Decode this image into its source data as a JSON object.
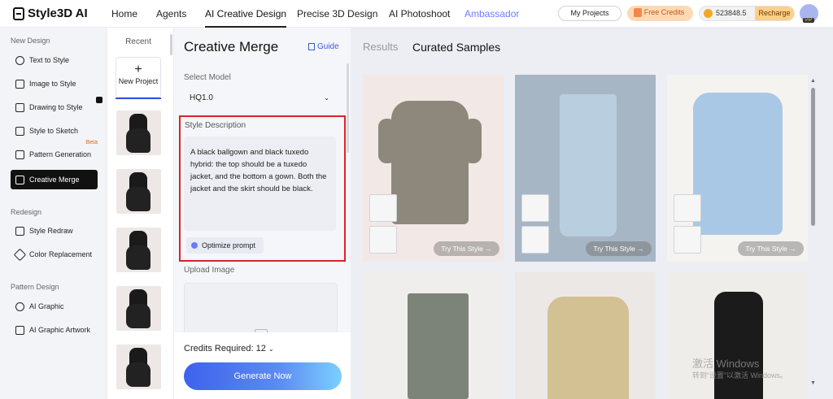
{
  "app": {
    "logo_text": "Style3D AI"
  },
  "topnav": {
    "items": [
      {
        "label": "Home"
      },
      {
        "label": "Agents"
      },
      {
        "label": "AI Creative Design"
      },
      {
        "label": "Precise 3D Design"
      },
      {
        "label": "AI Photoshoot"
      },
      {
        "label": "Ambassador"
      }
    ],
    "active": "AI Creative Design",
    "my_projects": "My Projects",
    "free_credits": "Free Credits",
    "credits_value": "523848.5",
    "recharge": "Recharge",
    "avatar_badge": "VIP"
  },
  "sidebar": {
    "sections": [
      {
        "title": "New Design",
        "items": [
          "Text to Style",
          "Image to Style",
          "Drawing to Style",
          "Style to Sketch",
          "Pattern Generation",
          "Creative Merge"
        ]
      },
      {
        "title": "Redesign",
        "items": [
          "Style Redraw",
          "Color Replacement"
        ]
      },
      {
        "title": "Pattern Design",
        "items": [
          "AI Graphic",
          "AI Graphic Artwork"
        ]
      }
    ],
    "beta_label": "Beta",
    "active": "Creative Merge"
  },
  "recent": {
    "title": "Recent",
    "new_project": "New Project"
  },
  "form": {
    "title": "Creative Merge",
    "guide": "Guide",
    "select_model_label": "Select Model",
    "model_value": "HQ1.0",
    "style_description_label": "Style Description",
    "style_description_text": "A black ballgown and black tuxedo hybrid: the top should be a tuxedo jacket, and the bottom a gown. Both the jacket and the skirt should be black.",
    "optimize_prompt": "Optimize prompt",
    "upload_image_label": "Upload Image",
    "credits_required": "Credits Required: 12",
    "generate_button": "Generate Now"
  },
  "results": {
    "tabs": [
      "Results",
      "Curated Samples"
    ],
    "active_tab": "Curated Samples",
    "try_label": "Try This Style →",
    "watermark_line1": "激活 Windows",
    "watermark_line2": "转到“设置”以激活 Windows。"
  },
  "colors": {
    "accent": "#3e62ec",
    "highlight_border": "#d9242a",
    "free_credits_bg": "#ffd9b3",
    "recharge_bg": "#ffcf8a"
  }
}
